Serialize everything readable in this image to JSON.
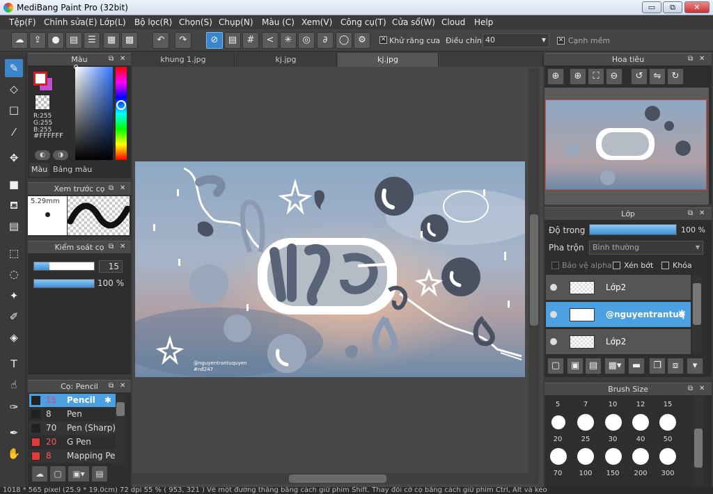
{
  "window": {
    "title": "MediBang Paint Pro (32bit)",
    "min": "▭",
    "max": "⧉",
    "close": "✕"
  },
  "menu": [
    "Tệp(F)",
    "Chỉnh sửa(E)",
    "Lớp(L)",
    "Bộ lọc(R)",
    "Chọn(S)",
    "Chụp(N)",
    "Màu (C)",
    "Xem(V)",
    "Công cụ(T)",
    "Cửa sổ(W)",
    "Cloud",
    "Help"
  ],
  "toolbar": {
    "antialias_label": "Khử răng cưa",
    "adjust_label": "Điều chỉnh",
    "adjust_value": "40",
    "smooth_label": "Cạnh mềm"
  },
  "color_panel": {
    "title": "Màu",
    "rgb": [
      "R:255",
      "G:255",
      "B:255"
    ],
    "hex": "#FFFFFF",
    "tab_color": "Màu",
    "tab_palette": "Bảng màu",
    "primary": "#ffffff",
    "secondary": "#c050d0"
  },
  "brush_preview": {
    "title": "Xem trước cọ",
    "size": "5.29mm"
  },
  "brush_control": {
    "title": "Kiểm soát cọ",
    "size_value": "15",
    "opacity_value": "100 %",
    "size_fraction": 0.25,
    "opacity_fraction": 1.0
  },
  "brush_list": {
    "title": "Cọ: Pencil",
    "items": [
      {
        "size": "15",
        "name": "Pencil",
        "color": "#222222"
      },
      {
        "size": "8",
        "name": "Pen",
        "color": "#222222"
      },
      {
        "size": "70",
        "name": "Pen (Sharp)",
        "color": "#222222"
      },
      {
        "size": "20",
        "name": "G Pen",
        "color": "#e03a3a"
      },
      {
        "size": "8",
        "name": "Mapping Pen",
        "color": "#e03a3a"
      }
    ]
  },
  "tabs": [
    "khung 1.jpg",
    "kj.jpg",
    "kj.jpg"
  ],
  "artwork": {
    "watermark_line1": "@nguyentrantuquyen",
    "watermark_line2": "#nđ247"
  },
  "navigator": {
    "title": "Hoa tiêu"
  },
  "layers_panel": {
    "title": "Lớp",
    "opacity_label": "Độ trong",
    "opacity_value": "100 %",
    "opacity_fraction": 1.0,
    "blend_label": "Pha trộn",
    "blend_value": "Bình thường",
    "protect_alpha": "Bảo vệ alpha",
    "clipping": "Xén bớt",
    "lock": "Khóa",
    "layers": [
      {
        "name": "Lớp2",
        "selected": false
      },
      {
        "name": "@nguyentrantuq",
        "selected": true
      },
      {
        "name": "Lớp2",
        "selected": false
      }
    ]
  },
  "brush_size": {
    "title": "Brush Size",
    "sizes": [
      "5",
      "7",
      "10",
      "12",
      "15",
      "20",
      "25",
      "30",
      "40",
      "50",
      "70",
      "100",
      "150",
      "200",
      "300"
    ]
  },
  "status": "1018 * 565 pixel  (25.9 * 19.0cm)  72 dpi  55 %  ( 953, 321 )  Vẽ một đường thẳng bằng cách giữ phím Shift. Thay đổi cỡ cọ bằng cách giữ phím Ctrl, Alt và kéo"
}
